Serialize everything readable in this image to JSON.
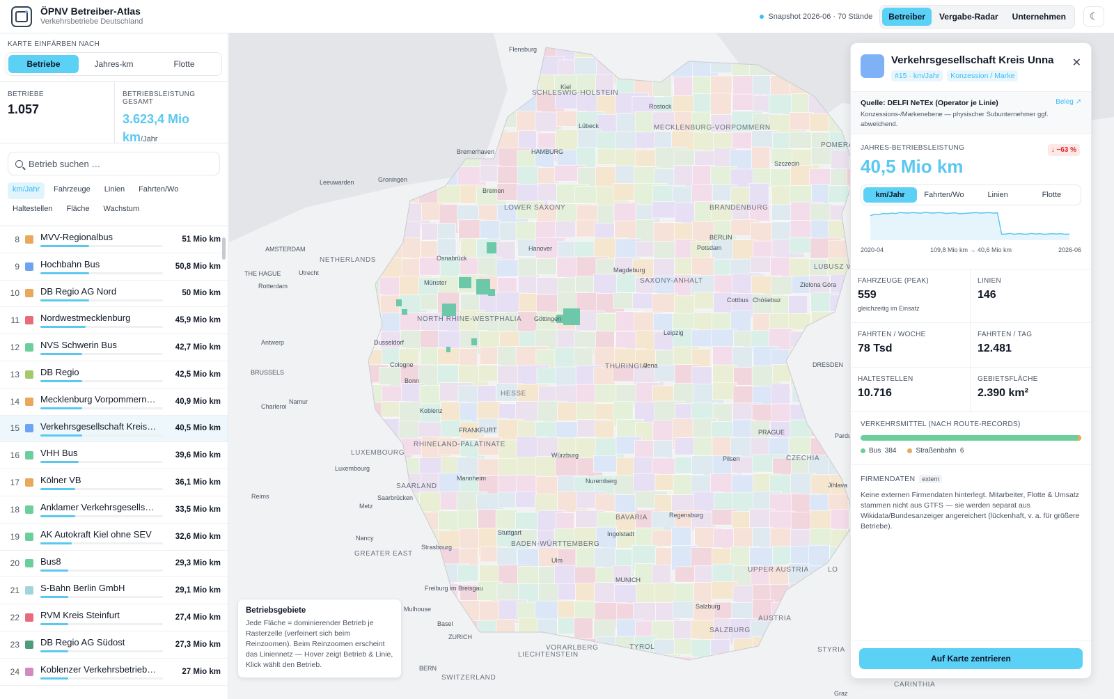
{
  "app": {
    "title": "ÖPNV Betreiber-Atlas",
    "subtitle": "Verkehrsbetriebe Deutschland"
  },
  "header": {
    "snapshot": "Snapshot 2026-06 · 70 Stände",
    "tabs": [
      "Betreiber",
      "Vergabe-Radar",
      "Unternehmen"
    ],
    "active_tab": "Betreiber"
  },
  "sidebar": {
    "color_label": "KARTE EINFÄRBEN NACH",
    "color_options": [
      "Betriebe",
      "Jahres-km",
      "Flotte"
    ],
    "stat_betriebe_label": "BETRIEBE",
    "stat_betriebe_value": "1.057",
    "stat_leistung_label": "BETRIEBSLEISTUNG GESAMT",
    "stat_leistung_value": "3.623,4 Mio km",
    "stat_leistung_unit": "/Jahr",
    "search_placeholder": "Betrieb suchen …",
    "chips": [
      "km/Jahr",
      "Fahrzeuge",
      "Linien",
      "Fahrten/Wo",
      "Haltestellen",
      "Fläche",
      "Wachstum"
    ],
    "rows": [
      {
        "rank": "8",
        "name": "MVV-Regionalbus",
        "value": "51 Mio km",
        "color": "#e9a85a",
        "bar": 0.14
      },
      {
        "rank": "9",
        "name": "Hochbahn Bus",
        "value": "50,8 Mio km",
        "color": "#6ea2f2",
        "bar": 0.14
      },
      {
        "rank": "10",
        "name": "DB Regio AG Nord",
        "value": "50 Mio km",
        "color": "#e9a85a",
        "bar": 0.14
      },
      {
        "rank": "11",
        "name": "Nordwestmecklenburg",
        "value": "45,9 Mio km",
        "color": "#e76b7a",
        "bar": 0.13
      },
      {
        "rank": "12",
        "name": "NVS Schwerin Bus",
        "value": "42,7 Mio km",
        "color": "#6ccf9b",
        "bar": 0.12
      },
      {
        "rank": "13",
        "name": "DB Regio",
        "value": "42,5 Mio km",
        "color": "#a3c96a",
        "bar": 0.12
      },
      {
        "rank": "14",
        "name": "Mecklenburg Vorpommern Verkehrsgesellschaft",
        "value": "40,9 Mio km",
        "color": "#e9a85a",
        "bar": 0.12
      },
      {
        "rank": "15",
        "name": "Verkehrsgesellschaft Kreis Unna",
        "value": "40,5 Mio km",
        "color": "#6ea2f2",
        "bar": 0.12,
        "selected": true
      },
      {
        "rank": "16",
        "name": "VHH Bus",
        "value": "39,6 Mio km",
        "color": "#6ccf9b",
        "bar": 0.11
      },
      {
        "rank": "17",
        "name": "Kölner VB",
        "value": "36,1 Mio km",
        "color": "#e9a85a",
        "bar": 0.1
      },
      {
        "rank": "18",
        "name": "Anklamer Verkehrsgesellschaft",
        "value": "33,5 Mio km",
        "color": "#6ccf9b",
        "bar": 0.1
      },
      {
        "rank": "19",
        "name": "AK Autokraft Kiel ohne SEV",
        "value": "32,6 Mio km",
        "color": "#6ccf9b",
        "bar": 0.09
      },
      {
        "rank": "20",
        "name": "Bus8",
        "value": "29,3 Mio km",
        "color": "#6ccf9b",
        "bar": 0.08
      },
      {
        "rank": "21",
        "name": "S-Bahn Berlin GmbH",
        "value": "29,1 Mio km",
        "color": "#9fd6dc",
        "bar": 0.08
      },
      {
        "rank": "22",
        "name": "RVM Kreis Steinfurt",
        "value": "27,4 Mio km",
        "color": "#e76b7a",
        "bar": 0.08
      },
      {
        "rank": "23",
        "name": "DB Regio AG Südost",
        "value": "27,3 Mio km",
        "color": "#4f9b7e",
        "bar": 0.08
      },
      {
        "rank": "24",
        "name": "Koblenzer Verkehrsbetriebe GmbH",
        "value": "27 Mio km",
        "color": "#d38ac2",
        "bar": 0.08
      }
    ]
  },
  "map": {
    "regions": [
      "SCHLESWIG-HOLSTEIN",
      "MECKLENBURG-VORPOMMERN",
      "LOWER SAXONY",
      "BRANDENBURG",
      "NETHERLANDS",
      "SAXONY-ANHALT",
      "NORTH RHINE-WESTPHALIA",
      "THURINGIA",
      "LOWER SAXONY",
      "HESSE",
      "RHINELAND-PALATINATE",
      "LUXEMBOURG",
      "SAARLAND",
      "BADEN-WÜRTTEMBERG",
      "BAVARIA",
      "GREATER EAST",
      "CZECHIA",
      "UPPER AUSTRIA",
      "AUSTRIA",
      "SALZBURG",
      "TYROL",
      "VORARLBERG",
      "LIECHTENSTEIN",
      "SWITZERLAND",
      "STYRIA",
      "CARINTHIA",
      "POMERA VOIVOD",
      "LUBUSZ VOIVODE",
      "LO"
    ],
    "cities": [
      "Flensburg",
      "Kiel",
      "Rostock",
      "Lübeck",
      "Bremerhaven",
      "HAMBURG",
      "Szczecin",
      "Leeuwarden",
      "Groningen",
      "Bremen",
      "AMSTERDAM",
      "Hanover",
      "BERLIN",
      "Potsdam",
      "THE HAGUE",
      "Utrecht",
      "Rotterdam",
      "Osnabrück",
      "Magdeburg",
      "Münster",
      "Zielona Góra",
      "Cottbus",
      "Chóśebuz",
      "Göttingen",
      "Leipzig",
      "Antwerp",
      "Dusseldorf",
      "DRESDEN",
      "BRUSSELS",
      "Cologne",
      "Jena",
      "Bonn",
      "Charleroi",
      "Namur",
      "Koblenz",
      "FRANKFURT",
      "PRAGUE",
      "Pardubic",
      "Würzburg",
      "Luxembourg",
      "Pilsen",
      "Mannheim",
      "Nuremberg",
      "Jihlava",
      "Reims",
      "Metz",
      "Saarbrücken",
      "Regensburg",
      "Nancy",
      "Stuttgart",
      "Ingolstadt",
      "Strasbourg",
      "Ulm",
      "MUNICH",
      "Linz",
      "Freiburg im Breisgau",
      "Mulhouse",
      "Salzburg",
      "Basel",
      "ZURICH",
      "BERN",
      "Graz"
    ],
    "legend_title": "Betriebsgebiete",
    "legend_text": "Jede Fläche = dominierender Betrieb je Rasterzelle (verfeinert sich beim Reinzoomen). Beim Reinzoomen erscheint das Liniennetz — Hover zeigt Betrieb & Linie, Klick wählt den Betrieb."
  },
  "detail": {
    "title": "Verkehrsgesellschaft Kreis Unna",
    "tag_rank": "#15 · km/Jahr",
    "tag_level": "Konzession / Marke",
    "source_title": "Quelle: DELFI NeTEx (Operator je Linie)",
    "source_link": "Beleg ↗",
    "source_text": "Konzessions-/Markenebene — physischer Subunternehmer ggf. abweichend.",
    "kpi_label": "JAHRES-BETRIEBSLEISTUNG",
    "kpi_value": "40,5 Mio km",
    "kpi_delta": "↓ −63 %",
    "kpi_tabs": [
      "km/Jahr",
      "Fahrten/Wo",
      "Linien",
      "Flotte"
    ],
    "spark_start": "2020-04",
    "spark_mid": "109,8 Mio km → 40,6 Mio km",
    "spark_end": "2026-06",
    "spark_values": [
      100,
      104,
      103,
      107,
      106,
      108,
      107,
      110,
      109,
      108,
      110,
      109,
      108,
      111,
      109,
      108,
      110,
      109,
      107,
      108,
      109,
      106,
      107,
      108,
      109,
      110,
      108,
      109,
      110,
      108,
      109,
      40,
      41,
      43,
      40,
      42,
      41,
      40,
      43,
      41,
      42,
      40,
      41,
      42,
      41,
      42,
      40,
      41
    ],
    "cells": [
      {
        "label": "FAHRZEUGE (PEAK)",
        "value": "559",
        "sub": "gleichzeitig im Einsatz"
      },
      {
        "label": "LINIEN",
        "value": "146",
        "sub": ""
      },
      {
        "label": "FAHRTEN / WOCHE",
        "value": "78 Tsd",
        "sub": ""
      },
      {
        "label": "FAHRTEN / TAG",
        "value": "12.481",
        "sub": ""
      },
      {
        "label": "HALTESTELLEN",
        "value": "10.716",
        "sub": ""
      },
      {
        "label": "GEBIETSFLÄCHE",
        "value": "2.390 km²",
        "sub": ""
      }
    ],
    "modes_label": "VERKEHRSMITTEL (NACH ROUTE-RECORDS)",
    "modes": [
      {
        "name": "Bus",
        "count": "384",
        "color": "#6ccf9b",
        "n": 384
      },
      {
        "name": "Straßenbahn",
        "count": "6",
        "color": "#e9a85a",
        "n": 6
      }
    ],
    "firm_label": "FIRMENDATEN",
    "firm_badge": "extern",
    "firm_text": "Keine externen Firmendaten hinterlegt. Mitarbeiter, Flotte & Umsatz stammen nicht aus GTFS — sie werden separat aus Wikidata/Bundesanzeiger angereichert (lückenhaft, v. a. für größere Betriebe).",
    "center_button": "Auf Karte zentrieren"
  },
  "colors": {
    "accent": "#5ad1f5",
    "accent_text": "#5ac8f0",
    "danger": "#dc2626"
  }
}
